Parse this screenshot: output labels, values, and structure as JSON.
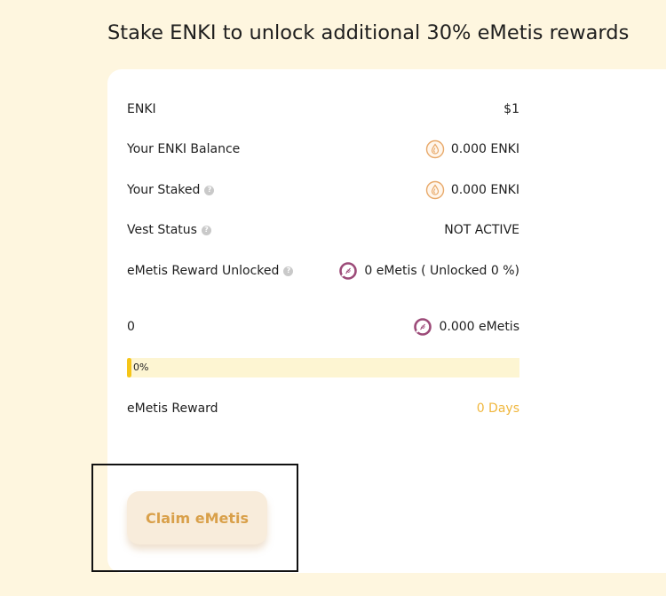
{
  "header": {
    "title": "Stake ENKI to unlock additional 30% eMetis rewards"
  },
  "rows": {
    "enki_price": {
      "label": "ENKI",
      "value": "$1"
    },
    "enki_balance": {
      "label": "Your ENKI Balance",
      "value": "0.000 ENKI",
      "icon": "enki-token-icon"
    },
    "staked": {
      "label": "Your Staked",
      "value": "0.000 ENKI",
      "icon": "enki-token-icon"
    },
    "vest_status": {
      "label": "Vest Status",
      "value": "NOT ACTIVE"
    },
    "reward_unlocked": {
      "label": "eMetis Reward Unlocked",
      "value": "0 eMetis ( Unlocked 0 %)",
      "icon": "emetis-token-icon"
    },
    "amount": {
      "label": "0",
      "value": "0.000 eMetis",
      "icon": "emetis-token-icon"
    },
    "emetis_reward": {
      "label": "eMetis Reward",
      "value": "0 Days"
    }
  },
  "progress": {
    "percent": 0,
    "label": "0%"
  },
  "actions": {
    "claim_label": "Claim eMetis"
  },
  "colors": {
    "background": "#fef6df",
    "accent_gold": "#f0b73e",
    "button_text": "#d9a04a",
    "button_bg": "#f8ecdb",
    "progress_fill": "#f5c518",
    "enki_icon": "#e8a96a",
    "emetis_icon": "#9c4a78"
  }
}
